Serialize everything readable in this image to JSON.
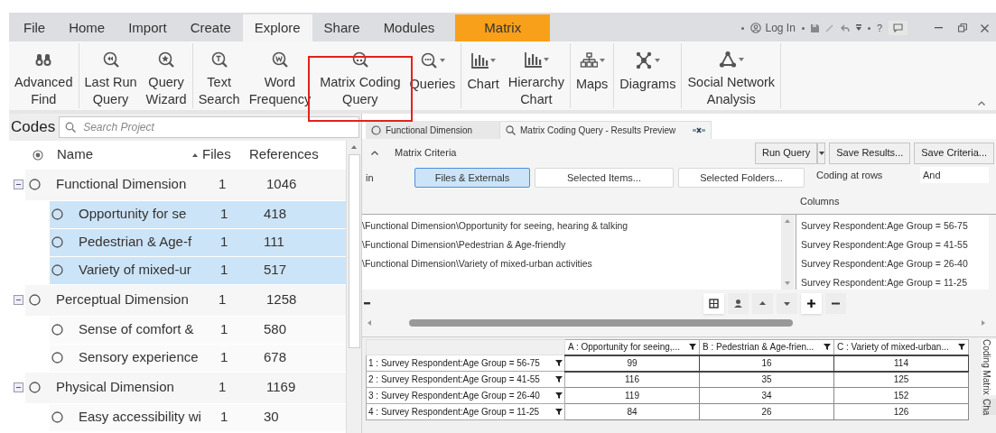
{
  "menu_tabs": [
    {
      "label": "File",
      "selected": false,
      "kind": "plain"
    },
    {
      "label": "Home",
      "selected": false,
      "kind": "plain"
    },
    {
      "label": "Import",
      "selected": false,
      "kind": "plain"
    },
    {
      "label": "Create",
      "selected": false,
      "kind": "plain"
    },
    {
      "label": "Explore",
      "selected": true,
      "kind": "plain"
    },
    {
      "label": "Share",
      "selected": false,
      "kind": "plain"
    },
    {
      "label": "Modules",
      "selected": false,
      "kind": "plain"
    },
    {
      "label": "Matrix",
      "selected": false,
      "kind": "context"
    }
  ],
  "title_bar": {
    "login": "Log In",
    "help": "?"
  },
  "ribbon": {
    "groups": [
      [
        {
          "lines": [
            "Advanced",
            "Find"
          ],
          "kind": "binoculars",
          "dropdown": false
        }
      ],
      [
        {
          "lines": [
            "Last Run",
            "Query"
          ],
          "kind": "rewind",
          "dropdown": false
        },
        {
          "lines": [
            "Query",
            "Wizard"
          ],
          "kind": "star",
          "dropdown": false
        }
      ],
      [
        {
          "lines": [
            "Text",
            "Search"
          ],
          "kind": "text",
          "dropdown": false
        },
        {
          "lines": [
            "Word",
            "Frequency"
          ],
          "kind": "word",
          "dropdown": false
        },
        {
          "lines": [
            "Matrix Coding",
            "Query"
          ],
          "kind": "matrix",
          "dropdown": false
        },
        {
          "lines": [
            "Queries"
          ],
          "kind": "queries",
          "dropdown": true
        }
      ],
      [
        {
          "lines": [
            "Chart"
          ],
          "kind": "chart",
          "dropdown": true
        },
        {
          "lines": [
            "Hierarchy",
            "Chart"
          ],
          "kind": "chart",
          "dropdown": true
        }
      ],
      [
        {
          "lines": [
            "Maps"
          ],
          "kind": "map",
          "dropdown": true
        }
      ],
      [
        {
          "lines": [
            "Diagrams"
          ],
          "kind": "diagram",
          "dropdown": true
        }
      ],
      [
        {
          "lines": [
            "Social Network",
            "Analysis"
          ],
          "kind": "network",
          "dropdown": true
        }
      ]
    ]
  },
  "codes_panel": {
    "title": "Codes",
    "search": {
      "placeholder": "Search Project"
    },
    "columns": [
      "Name",
      "Files",
      "References"
    ],
    "items": [
      {
        "name": "Functional Dimension",
        "files": "1",
        "references": "1046",
        "selected": false,
        "expanded": true,
        "children": [
          {
            "name": "Opportunity for se",
            "files": "1",
            "references": "418",
            "selected": true
          },
          {
            "name": "Pedestrian & Age-f",
            "files": "1",
            "references": "111",
            "selected": true
          },
          {
            "name": "Variety of mixed-ur",
            "files": "1",
            "references": "517",
            "selected": true
          }
        ]
      },
      {
        "name": "Perceptual Dimension",
        "files": "1",
        "references": "1258",
        "selected": false,
        "expanded": true,
        "children": [
          {
            "name": "Sense of comfort &",
            "files": "1",
            "references": "580",
            "selected": false
          },
          {
            "name": "Sensory experience",
            "files": "1",
            "references": "678",
            "selected": false
          }
        ]
      },
      {
        "name": "Physical Dimension",
        "files": "1",
        "references": "1169",
        "selected": false,
        "expanded": true,
        "children": [
          {
            "name": "Easy accessibility wi",
            "files": "1",
            "references": "30",
            "selected": false
          }
        ]
      }
    ]
  },
  "doc_tabs": [
    {
      "label": "Functional Dimension",
      "selected": false,
      "kind": "code"
    },
    {
      "label": "Matrix Coding Query - Results Preview",
      "selected": true,
      "kind": "query"
    }
  ],
  "criteria": {
    "title": "Matrix Criteria",
    "buttons": [
      "Run Query",
      "Save Results...",
      "Save Criteria..."
    ],
    "scope_label": "in",
    "scope_buttons": [
      {
        "label": "Files & Externals",
        "selected": true
      },
      {
        "label": "Selected Items...",
        "selected": false
      },
      {
        "label": "Selected Folders...",
        "selected": false
      }
    ],
    "coding_label": "Coding at rows",
    "coding_value": "And",
    "columns_label": "Columns",
    "rows": [
      "\\Functional Dimension\\Opportunity for seeing, hearing & talking",
      "\\Functional Dimension\\Pedestrian & Age-friendly",
      "\\Functional Dimension\\Variety of mixed-urban activities"
    ],
    "columns": [
      "Survey Respondent:Age Group = 56-75",
      "Survey Respondent:Age Group = 41-55",
      "Survey Respondent:Age Group = 26-40",
      "Survey Respondent:Age Group = 11-25"
    ]
  },
  "matrix": {
    "columns": [
      "A : Opportunity for seeing,...",
      "B : Pedestrian & Age-frien...",
      "C : Variety of mixed-urban..."
    ],
    "rows": [
      {
        "label": "1 : Survey Respondent:Age Group = 56-75",
        "values": [
          "99",
          "16",
          "114"
        ],
        "selected": true
      },
      {
        "label": "2 : Survey Respondent:Age Group = 41-55",
        "values": [
          "116",
          "35",
          "125"
        ],
        "selected": false
      },
      {
        "label": "3 : Survey Respondent:Age Group = 26-40",
        "values": [
          "119",
          "34",
          "152"
        ],
        "selected": false
      },
      {
        "label": "4 : Survey Respondent:Age Group = 11-25",
        "values": [
          "84",
          "26",
          "126"
        ],
        "selected": false
      }
    ]
  },
  "side_tabs": [
    {
      "label": "Coding Matrix",
      "selected": true
    },
    {
      "label": "Cha",
      "selected": false
    }
  ]
}
